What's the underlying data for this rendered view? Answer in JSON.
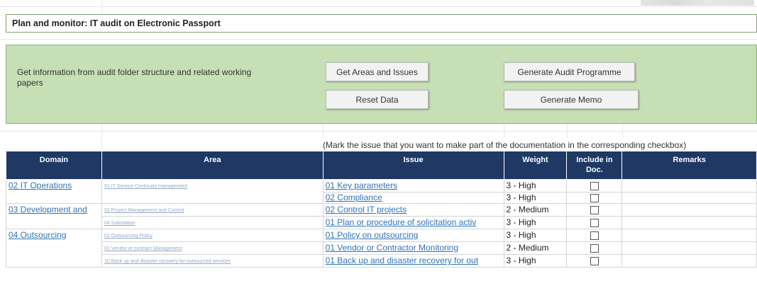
{
  "title": "Plan and monitor: IT audit on Electronic Passport",
  "panel": {
    "description": "Get information from audit folder structure and related working papers",
    "buttons": {
      "get_areas": "Get Areas and Issues",
      "generate_programme": "Generate Audit Programme",
      "reset": "Reset Data",
      "generate_memo": "Generate Memo"
    }
  },
  "instruction": "(Mark the issue that you want to make part of the documentation in the corresponding checkbox)",
  "table": {
    "headers": {
      "domain": "Domain",
      "area": "Area",
      "issue": "Issue",
      "weight": "Weight",
      "include": "Include in Doc.",
      "remarks": "Remarks"
    },
    "rows": [
      {
        "domain": "02 IT Operations",
        "area": "01 IT Service Continuity management",
        "issue": "01 Key parameters",
        "weight": "3 - High"
      },
      {
        "domain": "",
        "area": "",
        "issue": "02 Compliance",
        "weight": "3 - High"
      },
      {
        "domain": "03 Development and",
        "area": "02 Project Management and Control",
        "issue": "02 Control IT projects",
        "weight": "2 - Medium"
      },
      {
        "domain": "",
        "area": "04 Solicitation",
        "issue": "01 Plan or procedure of solicitation activ",
        "weight": "3 - High"
      },
      {
        "domain": "04 Outsourcing",
        "area": "01 Outsourcing Policy",
        "issue": "01 Policy on outsourcing",
        "weight": "3 - High"
      },
      {
        "domain": "",
        "area": "01 Vendor or contract Management",
        "issue": "01 Vendor or Contractor Monitoring",
        "weight": "2 - Medium"
      },
      {
        "domain": "",
        "area": "10 Back up and disaster recovery for outsourced services",
        "issue": "01 Back up and disaster recovery for out",
        "weight": "3 - High"
      }
    ]
  }
}
